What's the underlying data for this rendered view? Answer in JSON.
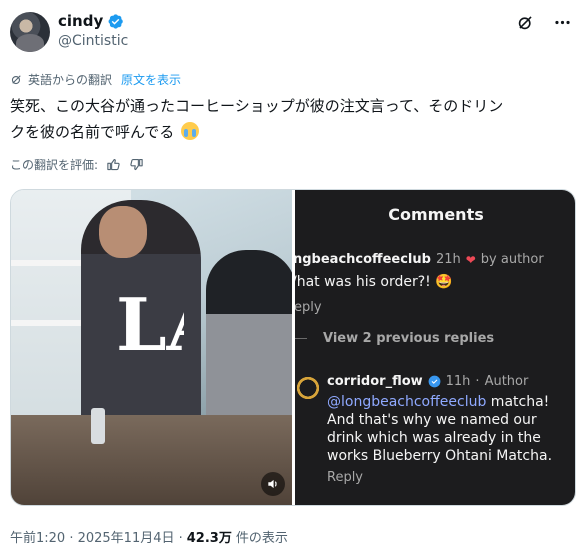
{
  "author": {
    "display_name": "cindy",
    "handle": "@Cintistic",
    "verified": true,
    "verified_color": "#1d9bf0"
  },
  "header_icons": [
    "grok-icon",
    "more-icon"
  ],
  "translation": {
    "label": "英語からの翻訳",
    "show_original": "原文を表示"
  },
  "tweet": {
    "text_line1": "笑死、この大谷が通ったコーヒーショップが彼の注文言って、そのドリン",
    "text_line2": "クを彼の名前で呼んでる",
    "emoji": "😭"
  },
  "rate": {
    "label": "この翻訳を評価:"
  },
  "media": {
    "logo_text": "LA",
    "comments_panel": {
      "title": "Comments",
      "comment1": {
        "user": "ngbeachcoffeeclub",
        "time": "21h",
        "by_author": "by author",
        "text": "/hat was his order?!",
        "emoji": "🤩",
        "reply": "eply"
      },
      "view_previous": "View 2 previous replies",
      "comment2": {
        "user": "corridor_flow",
        "time": "11h",
        "author_label": "Author",
        "mention": "@longbeachcoffeeclub",
        "text": " matcha! And that's why we named our drink which was already in the works Blueberry Ohtani Matcha.",
        "reply": "Reply"
      }
    }
  },
  "meta": {
    "time": "午前1:20 · 2025年11月4日 ·",
    "views": "42.3万",
    "views_label": "件の表示"
  },
  "colors": {
    "link": "#1d9bf0",
    "muted": "#536471",
    "comments_bg": "#1c1c1e"
  }
}
